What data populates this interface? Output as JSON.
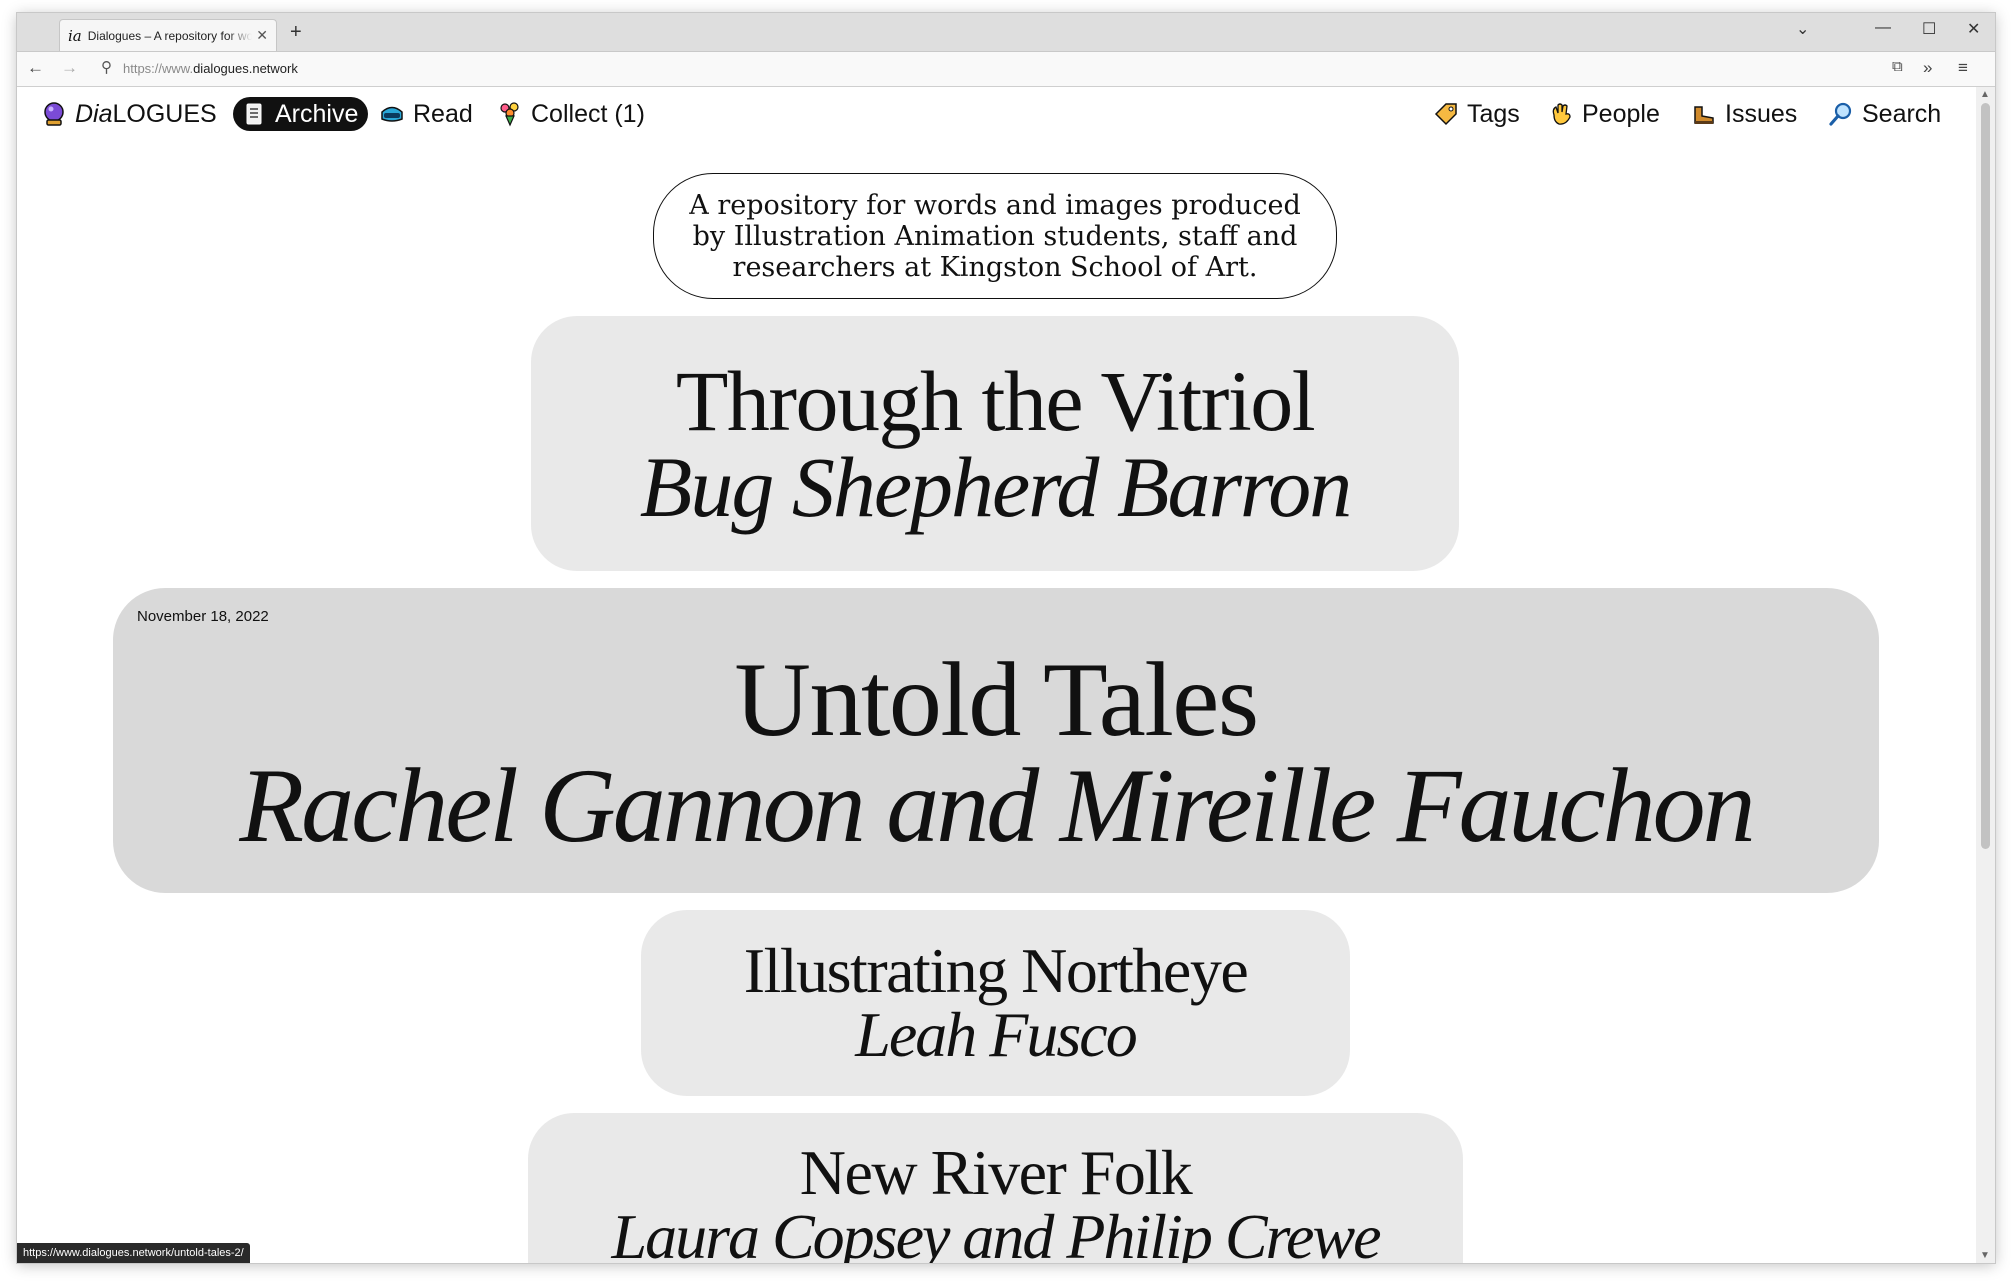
{
  "browser": {
    "tab_favicon": "ia",
    "tab_title": "Dialogues – A repository for words and images",
    "url_scheme_prefix": "https://www.",
    "url_domain": "dialogues.network",
    "status_url": "https://www.dialogues.network/untold-tales-2/"
  },
  "site_nav": {
    "logo_prefix": "Dia",
    "logo_suffix": "LOGUES",
    "left_items": [
      {
        "label": "Archive",
        "icon": "notebook-icon",
        "active": true
      },
      {
        "label": "Read",
        "icon": "vr-goggles-icon"
      },
      {
        "label": "Collect (1)",
        "icon": "bouquet-icon"
      }
    ],
    "right_items": [
      {
        "label": "Tags",
        "icon": "label-tag-icon"
      },
      {
        "label": "People",
        "icon": "waving-hand-icon"
      },
      {
        "label": "Issues",
        "icon": "boot-icon"
      },
      {
        "label": "Search",
        "icon": "magnifier-icon"
      }
    ]
  },
  "intro": "A repository for words and images produced by Illustration Animation students, staff and researchers at Kingston School of Art.",
  "entries": [
    {
      "title": "Through the Vitriol",
      "author": "Bug Shepherd Barron"
    },
    {
      "date": "November 18, 2022",
      "title": "Untold Tales",
      "author": "Rachel Gannon and Mireille Fauchon",
      "featured": true
    },
    {
      "title": "Illustrating Northeye",
      "author": "Leah Fusco"
    },
    {
      "title": "New River Folk",
      "author": "Laura Copsey and Philip Crewe"
    }
  ],
  "colors": {
    "card_bg": "#e9e9e9",
    "featured_card_bg": "#d9d9d9",
    "text": "#111111",
    "active_pill": "#111111"
  }
}
